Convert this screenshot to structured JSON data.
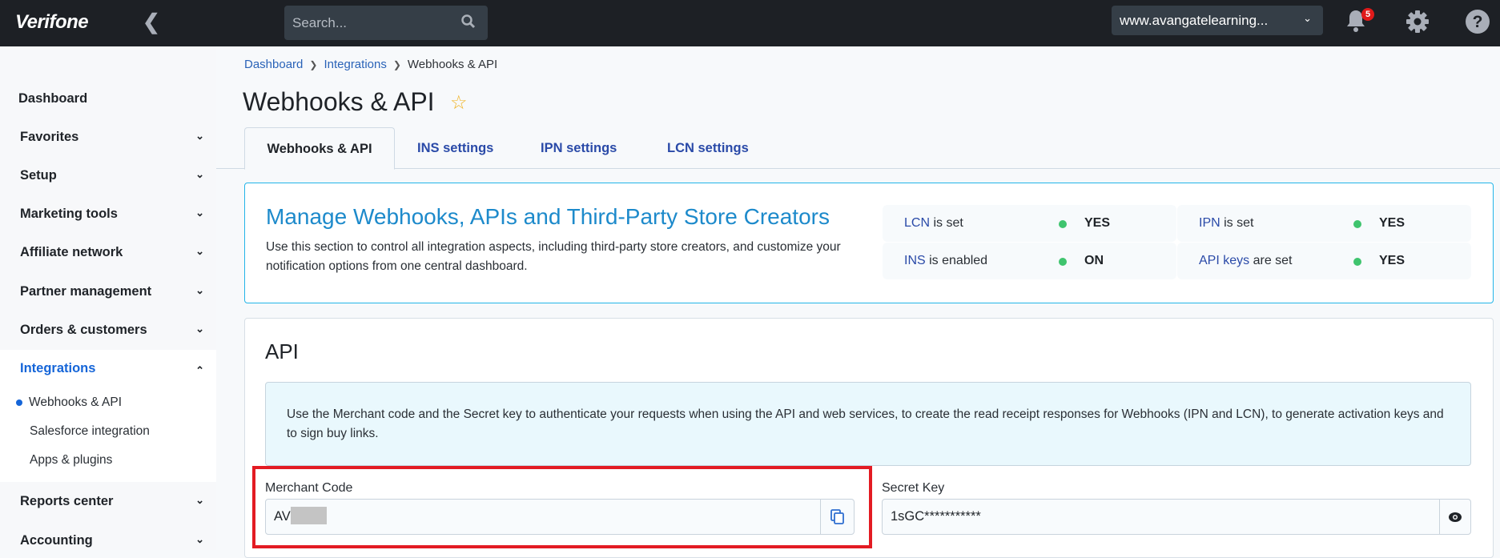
{
  "header": {
    "logo": "Verifone",
    "search_placeholder": "Search...",
    "domain": "www.avangatelearning...",
    "notifications_count": "5"
  },
  "sidebar": {
    "items": [
      {
        "label": "Dashboard"
      },
      {
        "label": "Favorites"
      },
      {
        "label": "Setup"
      },
      {
        "label": "Marketing tools"
      },
      {
        "label": "Affiliate network"
      },
      {
        "label": "Partner management"
      },
      {
        "label": "Orders & customers"
      },
      {
        "label": "Integrations"
      },
      {
        "label": "Reports center"
      },
      {
        "label": "Accounting"
      }
    ],
    "sub_items": [
      {
        "label": "Webhooks & API"
      },
      {
        "label": "Salesforce integration"
      },
      {
        "label": "Apps & plugins"
      }
    ]
  },
  "breadcrumb": [
    "Dashboard",
    "Integrations",
    "Webhooks & API"
  ],
  "page_title": "Webhooks & API",
  "tabs": [
    "Webhooks & API",
    "INS settings",
    "IPN settings",
    "LCN settings"
  ],
  "manage": {
    "title": "Manage Webhooks, APIs and Third-Party Store Creators",
    "description": "Use this section to control all integration aspects, including third-party store creators, and customize your notification options from one central dashboard.",
    "status": [
      {
        "link": "LCN",
        "rest": " is set",
        "value": "YES"
      },
      {
        "link": "IPN",
        "rest": " is set",
        "value": "YES"
      },
      {
        "link": "INS",
        "rest": " is enabled",
        "value": "ON"
      },
      {
        "link": "API keys",
        "rest": " are set",
        "value": "YES"
      }
    ]
  },
  "api": {
    "heading": "API",
    "info": "Use the Merchant code and the Secret key to authenticate your requests when using the API and web services, to create the read receipt responses for Webhooks (IPN and LCN), to generate activation keys and to sign buy links.",
    "merchant_label": "Merchant Code",
    "merchant_value": "AV",
    "secret_label": "Secret Key",
    "secret_value": "1sGC***********"
  }
}
